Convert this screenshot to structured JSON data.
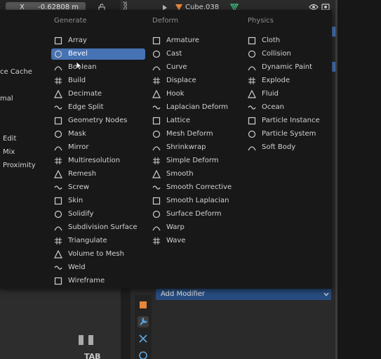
{
  "topbar": {
    "axis_label": "X",
    "x_value": "-0.62808 m",
    "side_tab": "Tool",
    "object_name": "Cube.038"
  },
  "menu": {
    "generate_header": "Generate",
    "deform_header": "Deform",
    "physics_header": "Physics",
    "generate": [
      {
        "label": "Array",
        "icon": "array-icon"
      },
      {
        "label": "Bevel",
        "icon": "bevel-icon",
        "highlighted": true
      },
      {
        "label": "Boolean",
        "icon": "boolean-icon"
      },
      {
        "label": "Build",
        "icon": "build-icon"
      },
      {
        "label": "Decimate",
        "icon": "decimate-icon"
      },
      {
        "label": "Edge Split",
        "icon": "edge-split-icon"
      },
      {
        "label": "Geometry Nodes",
        "icon": "geometry-nodes-icon"
      },
      {
        "label": "Mask",
        "icon": "mask-icon"
      },
      {
        "label": "Mirror",
        "icon": "mirror-icon"
      },
      {
        "label": "Multiresolution",
        "icon": "multires-icon"
      },
      {
        "label": "Remesh",
        "icon": "remesh-icon"
      },
      {
        "label": "Screw",
        "icon": "screw-icon"
      },
      {
        "label": "Skin",
        "icon": "skin-icon"
      },
      {
        "label": "Solidify",
        "icon": "solidify-icon"
      },
      {
        "label": "Subdivision Surface",
        "icon": "subsurf-icon"
      },
      {
        "label": "Triangulate",
        "icon": "triangulate-icon"
      },
      {
        "label": "Volume to Mesh",
        "icon": "volume-to-mesh-icon"
      },
      {
        "label": "Weld",
        "icon": "weld-icon"
      },
      {
        "label": "Wireframe",
        "icon": "wireframe-icon"
      }
    ],
    "deform": [
      {
        "label": "Armature",
        "icon": "armature-icon"
      },
      {
        "label": "Cast",
        "icon": "cast-icon"
      },
      {
        "label": "Curve",
        "icon": "curve-icon"
      },
      {
        "label": "Displace",
        "icon": "displace-icon"
      },
      {
        "label": "Hook",
        "icon": "hook-icon"
      },
      {
        "label": "Laplacian Deform",
        "icon": "laplacian-deform-icon"
      },
      {
        "label": "Lattice",
        "icon": "lattice-icon"
      },
      {
        "label": "Mesh Deform",
        "icon": "mesh-deform-icon"
      },
      {
        "label": "Shrinkwrap",
        "icon": "shrinkwrap-icon"
      },
      {
        "label": "Simple Deform",
        "icon": "simple-deform-icon"
      },
      {
        "label": "Smooth",
        "icon": "smooth-icon"
      },
      {
        "label": "Smooth Corrective",
        "icon": "smooth-corrective-icon"
      },
      {
        "label": "Smooth Laplacian",
        "icon": "smooth-laplacian-icon"
      },
      {
        "label": "Surface Deform",
        "icon": "surface-deform-icon"
      },
      {
        "label": "Warp",
        "icon": "warp-icon"
      },
      {
        "label": "Wave",
        "icon": "wave-icon"
      }
    ],
    "physics": [
      {
        "label": "Cloth",
        "icon": "cloth-icon"
      },
      {
        "label": "Collision",
        "icon": "collision-icon"
      },
      {
        "label": "Dynamic Paint",
        "icon": "dynamic-paint-icon"
      },
      {
        "label": "Explode",
        "icon": "explode-icon"
      },
      {
        "label": "Fluid",
        "icon": "fluid-icon"
      },
      {
        "label": "Ocean",
        "icon": "ocean-icon"
      },
      {
        "label": "Particle Instance",
        "icon": "particle-instance-icon"
      },
      {
        "label": "Particle System",
        "icon": "particle-system-icon"
      },
      {
        "label": "Soft Body",
        "icon": "soft-body-icon"
      }
    ],
    "left_partial": [
      {
        "label": "ce Cache"
      },
      {
        "label": "mal"
      },
      {
        "label": "Edit"
      },
      {
        "label": "Mix"
      },
      {
        "label": "Proximity"
      }
    ]
  },
  "properties": {
    "add_modifier_label": "Add Modifier"
  },
  "viewport": {
    "tab_hint": "TAB"
  },
  "colors": {
    "highlight": "#4772b3",
    "menu_bg": "#181818",
    "add_modifier_bg": "#284d80"
  }
}
